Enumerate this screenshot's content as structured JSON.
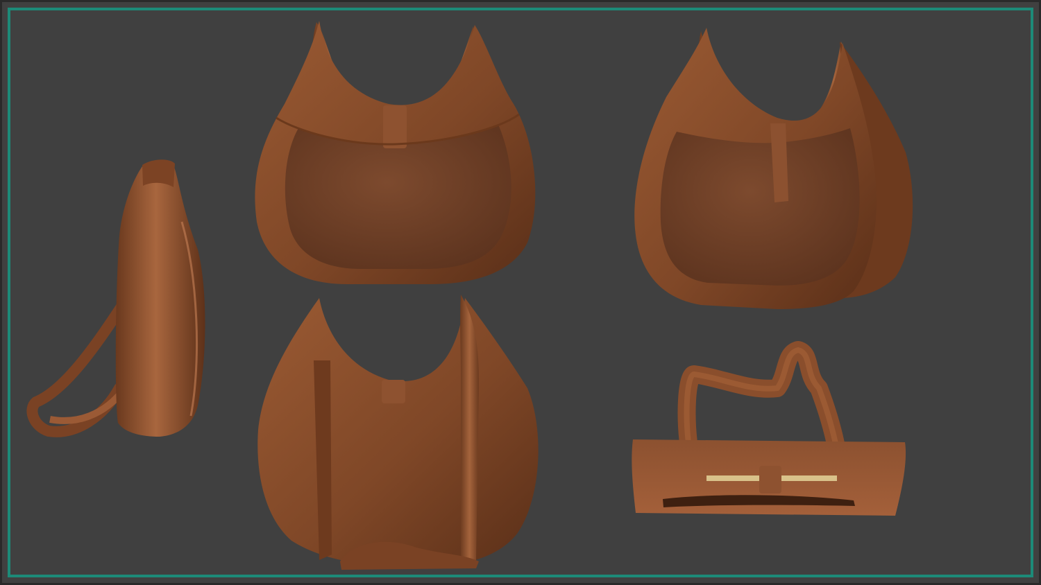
{
  "canvas": {
    "background_color": "#404040",
    "border_color": "#1d8a78"
  },
  "materials": {
    "leather_base": "#8a4f2c",
    "leather_light": "#a9643b",
    "leather_dark": "#5e3119",
    "leather_shadow": "#3e2010",
    "zipper": "#d9c28a"
  },
  "views": [
    {
      "name": "side-view"
    },
    {
      "name": "front-view"
    },
    {
      "name": "back-view"
    },
    {
      "name": "three-quarter-view"
    },
    {
      "name": "top-view"
    }
  ]
}
